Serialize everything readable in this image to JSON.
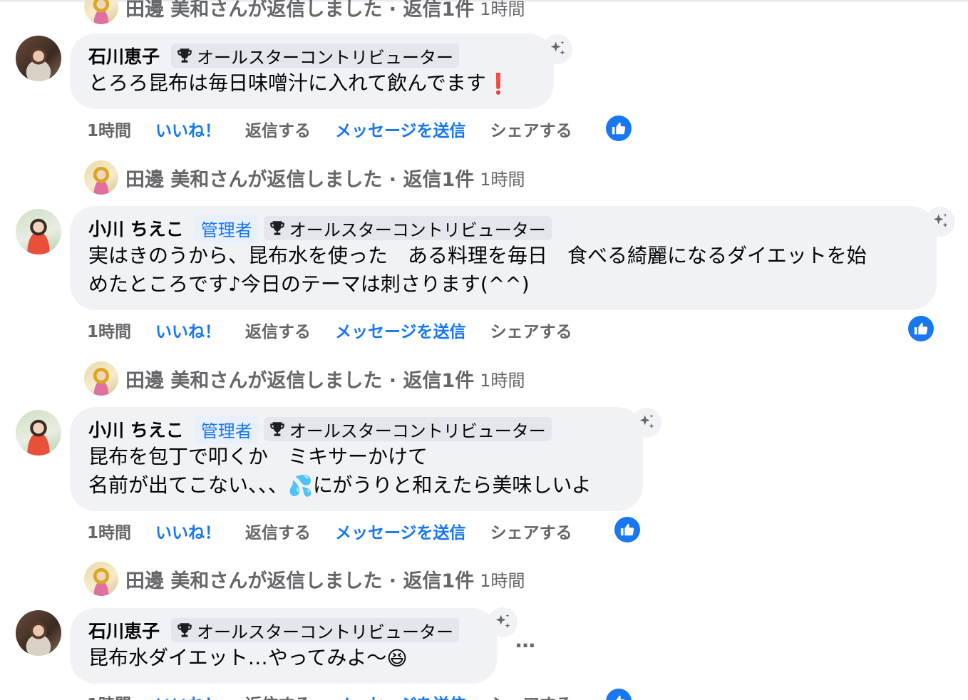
{
  "reply_summary": {
    "text": "田邊 美和さんが返信しました · 返信1件",
    "time": "1時間"
  },
  "actions": {
    "time": "1時間",
    "like": "いいね！",
    "reply": "返信する",
    "message": "メッセージを送信",
    "share": "シェアする"
  },
  "badges": {
    "admin": "管理者",
    "contributor": "オールスターコントリビューター"
  },
  "comments": [
    {
      "author": "石川恵子",
      "lines": [
        "とろろ昆布は毎日味噌汁に入れて飲んでます"
      ],
      "emoji": "❗"
    },
    {
      "author": "小川 ちえこ",
      "lines": [
        "実はきのうから、昆布水を使った　ある料理を毎日　食べる綺麗になるダイエットを始",
        "めたところです♪今日のテーマは刺さります(^^)"
      ]
    },
    {
      "author": "小川 ちえこ",
      "lines": [
        "昆布を包丁で叩くか　ミキサーかけて",
        "名前が出てこない、、、",
        "にがうりと和えたら美味しいよ"
      ],
      "emoji": "💦"
    },
    {
      "author": "石川恵子",
      "lines": [
        "昆布水ダイエット…やってみよ〜"
      ],
      "emoji": "😆"
    }
  ],
  "more_label": "…",
  "colors": {
    "accent": "#1877f2",
    "bubble": "#f0f2f5",
    "secondary_text": "#65676b"
  }
}
